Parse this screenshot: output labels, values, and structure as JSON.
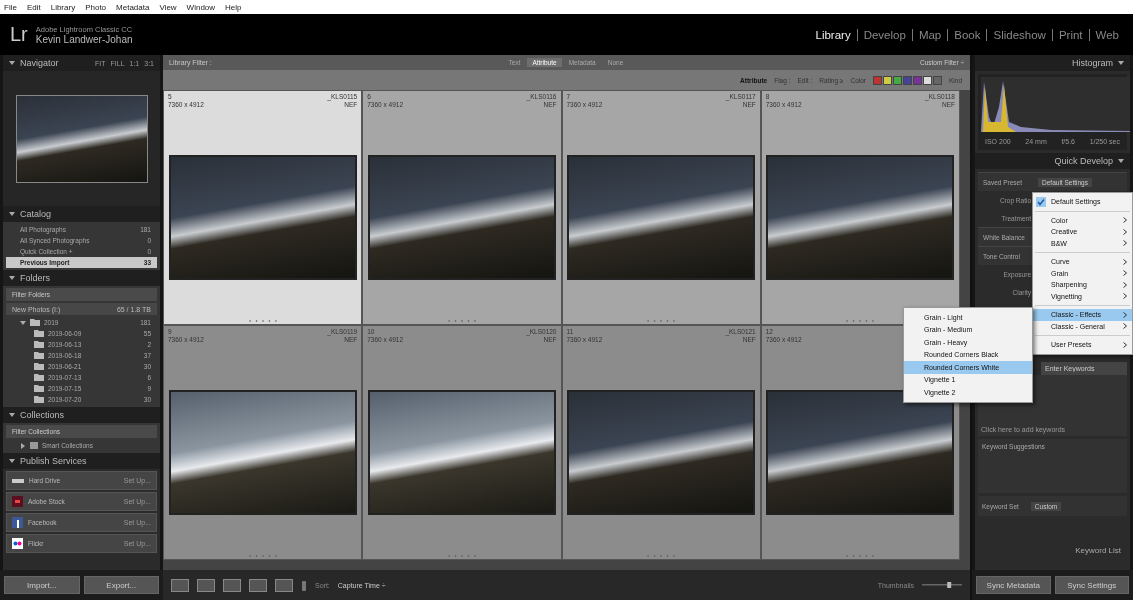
{
  "menubar": [
    "File",
    "Edit",
    "Library",
    "Photo",
    "Metadata",
    "View",
    "Window",
    "Help"
  ],
  "identity": {
    "logo": "Lr",
    "product": "Adobe Lightroom Classic CC",
    "user": "Kevin Landwer-Johan"
  },
  "modules": [
    {
      "label": "Library",
      "selected": true
    },
    {
      "label": "Develop",
      "selected": false
    },
    {
      "label": "Map",
      "selected": false
    },
    {
      "label": "Book",
      "selected": false
    },
    {
      "label": "Slideshow",
      "selected": false
    },
    {
      "label": "Print",
      "selected": false
    },
    {
      "label": "Web",
      "selected": false
    }
  ],
  "navigator": {
    "title": "Navigator",
    "zoom_options": [
      "FIT",
      "FILL",
      "1:1",
      "3:1"
    ]
  },
  "catalog": {
    "title": "Catalog",
    "items": [
      {
        "label": "All Photographs",
        "count": "181",
        "selected": false
      },
      {
        "label": "All Synced Photographs",
        "count": "0",
        "selected": false
      },
      {
        "label": "Quick Collection +",
        "count": "0",
        "selected": false
      },
      {
        "label": "Previous Import",
        "count": "33",
        "selected": true
      }
    ]
  },
  "folders": {
    "title": "Folders",
    "filter": "Filter Folders",
    "volume": {
      "name": "New Photos (I:)",
      "usage": "65 / 1.8 TB"
    },
    "tree": [
      {
        "label": "2019",
        "count": "181",
        "expanded": true,
        "children": [
          {
            "label": "2019-06-09",
            "count": "55"
          },
          {
            "label": "2019-06-13",
            "count": "2"
          },
          {
            "label": "2019-06-18",
            "count": "37"
          },
          {
            "label": "2019-06-21",
            "count": "30"
          },
          {
            "label": "2019-07-13",
            "count": "6"
          },
          {
            "label": "2019-07-15",
            "count": "9"
          },
          {
            "label": "2019-07-20",
            "count": "30"
          }
        ]
      }
    ]
  },
  "collections": {
    "title": "Collections",
    "filter": "Filter Collections",
    "items": [
      {
        "label": "Smart Collections",
        "expanded": false
      }
    ]
  },
  "publish_services": {
    "title": "Publish Services",
    "services": [
      {
        "kind": "drive",
        "name": "Hard Drive",
        "action": "Set Up..."
      },
      {
        "kind": "stock",
        "name": "Adobe Stock",
        "action": "Set Up..."
      },
      {
        "kind": "facebook",
        "name": "Facebook",
        "action": "Set Up..."
      },
      {
        "kind": "flickr",
        "name": "Flickr",
        "action": "Set Up..."
      }
    ]
  },
  "left_buttons": [
    "Import...",
    "Export..."
  ],
  "library_filter": {
    "label": "Library Filter :",
    "tabs": [
      {
        "label": "Text",
        "selected": false
      },
      {
        "label": "Attribute",
        "selected": true
      },
      {
        "label": "Metadata",
        "selected": false
      },
      {
        "label": "None",
        "selected": false
      }
    ],
    "preset": "Custom Filter ÷",
    "attribute_label": "Attribute",
    "groups": [
      "Flag :",
      "Edit :",
      "Rating ≥",
      "Color",
      "Kind"
    ]
  },
  "grid": [
    {
      "index": "5",
      "filename": "_KLS0115",
      "dimensions": "7360 x 4912",
      "format": "NEF",
      "selected": true
    },
    {
      "index": "6",
      "filename": "_KLS0116",
      "dimensions": "7360 x 4912",
      "format": "NEF",
      "selected": false
    },
    {
      "index": "7",
      "filename": "_KLS0117",
      "dimensions": "7360 x 4912",
      "format": "NEF",
      "selected": false
    },
    {
      "index": "8",
      "filename": "_KLS0118",
      "dimensions": "7360 x 4912",
      "format": "NEF",
      "selected": false
    },
    {
      "index": "9",
      "filename": "_KLS0119",
      "dimensions": "7360 x 4912",
      "format": "NEF",
      "selected": false
    },
    {
      "index": "10",
      "filename": "_KLS0120",
      "dimensions": "7360 x 4912",
      "format": "NEF",
      "selected": false
    },
    {
      "index": "11",
      "filename": "_KLS0121",
      "dimensions": "7360 x 4912",
      "format": "NEF",
      "selected": false
    },
    {
      "index": "12",
      "dimensions": "7360 x 4912",
      "selected": false
    }
  ],
  "toolbar": {
    "sort_label": "Sort:",
    "sort_value": "Capture Time ÷",
    "thumbnails_label": "Thumbnails",
    "thumbnail_size": {
      "level": 0.7
    }
  },
  "histogram": {
    "title": "Histogram",
    "readings": [
      "ISO 200",
      "24 mm",
      "f/5.6",
      "1/250 sec"
    ]
  },
  "quick_develop": {
    "title": "Quick Develop",
    "rows": [
      {
        "kind": "preset",
        "label": "Saved Preset",
        "value": "Default Settings"
      },
      {
        "kind": "field",
        "label": "Crop Ratio"
      },
      {
        "kind": "field",
        "label": "Treatment"
      },
      {
        "kind": "section",
        "label": "White Balance"
      },
      {
        "kind": "section",
        "label": "Tone Control"
      },
      {
        "kind": "field",
        "label": "Exposure"
      },
      {
        "kind": "field",
        "label": "Clarity"
      }
    ]
  },
  "keywording": {
    "placeholder": "Enter Keywords",
    "hint": "Click here to add keywords",
    "suggestions": "Keyword Suggestions",
    "set_label": "Keyword Set",
    "set_value": "Custom",
    "list_title": "Keyword List"
  },
  "right_buttons": [
    "Sync Metadata",
    "Sync Settings"
  ],
  "preset_menu": {
    "items": [
      {
        "kind": "item",
        "label": "Default Settings",
        "checked": true,
        "has_submenu": false,
        "selected": false
      },
      {
        "kind": "separator"
      },
      {
        "kind": "item",
        "label": "Color",
        "checked": false,
        "has_submenu": true,
        "selected": false
      },
      {
        "kind": "item",
        "label": "Creative",
        "checked": false,
        "has_submenu": true,
        "selected": false
      },
      {
        "kind": "item",
        "label": "B&W",
        "checked": false,
        "has_submenu": true,
        "selected": false
      },
      {
        "kind": "separator"
      },
      {
        "kind": "item",
        "label": "Curve",
        "checked": false,
        "has_submenu": true,
        "selected": false
      },
      {
        "kind": "item",
        "label": "Grain",
        "checked": false,
        "has_submenu": true,
        "selected": false
      },
      {
        "kind": "item",
        "label": "Sharpening",
        "checked": false,
        "has_submenu": true,
        "selected": false
      },
      {
        "kind": "item",
        "label": "Vignetting",
        "checked": false,
        "has_submenu": true,
        "selected": false
      },
      {
        "kind": "separator"
      },
      {
        "kind": "item",
        "label": "Classic - Effects",
        "checked": false,
        "has_submenu": true,
        "selected": true
      },
      {
        "kind": "item",
        "label": "Classic - General",
        "checked": false,
        "has_submenu": true,
        "selected": false
      },
      {
        "kind": "separator"
      },
      {
        "kind": "item",
        "label": "User Presets",
        "checked": false,
        "has_submenu": true,
        "selected": false
      }
    ],
    "submenu": [
      {
        "label": "Grain - Light",
        "selected": false
      },
      {
        "label": "Grain - Medium",
        "selected": false
      },
      {
        "label": "Grain - Heavy",
        "selected": false
      },
      {
        "label": "Rounded Corners Black",
        "selected": false
      },
      {
        "label": "Rounded Corners White",
        "selected": true
      },
      {
        "label": "Vignette 1",
        "selected": false
      },
      {
        "label": "Vignette 2",
        "selected": false
      }
    ]
  }
}
